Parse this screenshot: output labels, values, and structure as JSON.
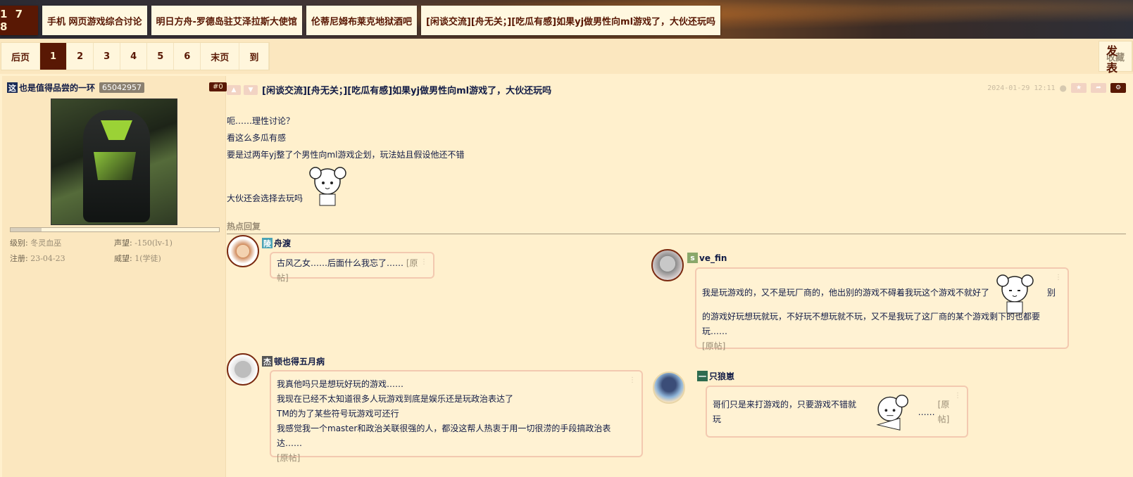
{
  "breadcrumbs": {
    "home": "1 7 8",
    "items": [
      "手机 网页游戏综合讨论",
      "明日方舟-罗德岛驻艾泽拉斯大使馆",
      "伦蒂尼姆布莱克地狱酒吧",
      "[闲谈交流][舟无关；][吃瓜有感]如果yj做男性向ml游戏了，大伙还玩吗"
    ]
  },
  "pager": {
    "prev": "后页",
    "pages": [
      "1",
      "2",
      "3",
      "4",
      "5",
      "6"
    ],
    "active": "1",
    "last": "末页",
    "goto": "到"
  },
  "actions": {
    "favorite": "收藏",
    "reply": "发表回复"
  },
  "author": {
    "badge": "这",
    "name": "也是值得品尝的一环",
    "uid": "65042957",
    "floor": "#0",
    "level_label": "级别:",
    "level": "冬灵血巫",
    "fame_label": "声望:",
    "fame": "-150(lv-1)",
    "reg_label": "注册:",
    "reg": "23-04-23",
    "prestige_label": "威望:",
    "prestige": "1(学徒)",
    "progress": 0.15
  },
  "post": {
    "title": "[闲谈交流][舟无关；][吃瓜有感]如果yj做男性向ml游戏了，大伙还玩吗",
    "date": "2024-01-29 12:11",
    "lines": [
      "呃……理性讨论？",
      "看这么多瓜有感",
      "要是过两年yj整了个男性向ml游戏企划，玩法姑且假设他还不错",
      "大伙还会选择去玩吗"
    ]
  },
  "hot_replies": {
    "heading": "热点回复",
    "items": [
      {
        "badge": "陵",
        "badge_color": "#4aa3b5",
        "name": "舟渡",
        "lines": [
          "古风乙女……后面什么我忘了……"
        ],
        "orig": "[原帖]"
      },
      {
        "badge": "s",
        "badge_color": "#8aa86a",
        "name": "ve_fin",
        "lines": [
          "我是玩游戏的，又不是玩厂商的，他出别的游戏不碍着我玩这个游戏不就好了",
          "别",
          "的游戏好玩想玩就玩，不好玩不想玩就不玩，又不是我玩了这厂商的某个游戏剩下的也都要玩……"
        ],
        "orig": "[原帖]"
      },
      {
        "badge": "杰",
        "badge_color": "#555555",
        "name": "顿也得五月病",
        "lines": [
          "我真他吗只是想玩好玩的游戏……",
          "我现在已经不太知道很多人玩游戏到底是娱乐还是玩政治表达了",
          "TM的为了某些符号玩游戏可还行",
          "我感觉我一个master和政治关联很强的人，都没这帮人热衷于用一切很涝的手段搞政治表达……"
        ],
        "orig": "[原帖]"
      },
      {
        "badge": "一",
        "badge_color": "#2e6b4f",
        "name": "只狼崽",
        "lines": [
          "哥们只是来打游戏的，只要游戏不错就玩",
          "……"
        ],
        "orig": "[原帖]"
      }
    ]
  },
  "colors": {
    "brand": "#591804",
    "bg": "#fff0cd",
    "text": "#121c46"
  }
}
